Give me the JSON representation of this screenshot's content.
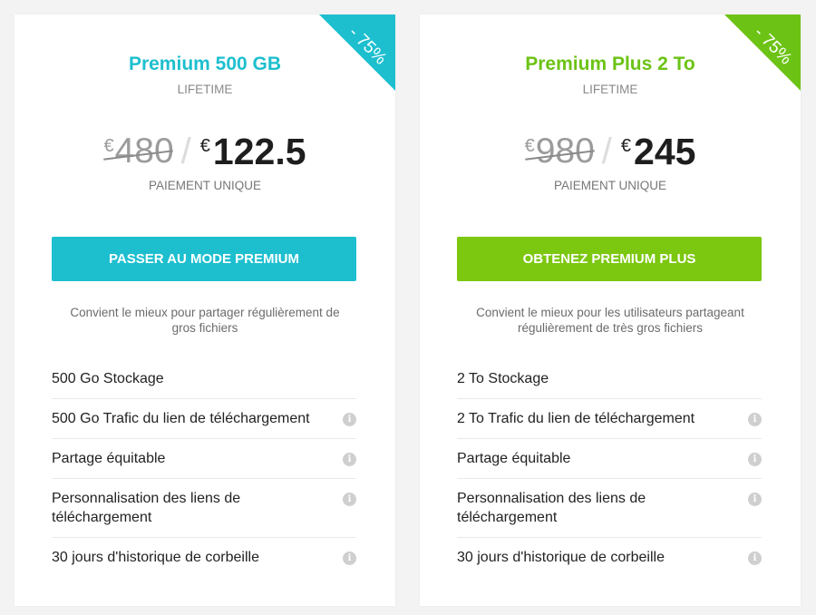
{
  "plans": [
    {
      "ribbon": "- 75%",
      "title": "Premium 500 GB",
      "term": "LIFETIME",
      "currency": "€",
      "old_price": "480",
      "separator": "/",
      "new_price": "122.5",
      "payment_note": "PAIEMENT UNIQUE",
      "cta_label": "PASSER AU MODE PREMIUM",
      "description": "Convient le mieux pour partager régulièrement de gros fichiers",
      "accent_color": "#1dbfcf",
      "button_color": "#1dbfcf",
      "features": [
        {
          "label": "500 Go Stockage",
          "icon": null
        },
        {
          "label": "500 Go Trafic du lien de téléchargement",
          "icon": "info-icon"
        },
        {
          "label": "Partage équitable",
          "icon": "info-icon"
        },
        {
          "label": "Personnalisation des liens de téléchargement",
          "icon": "info-icon"
        },
        {
          "label": "30 jours d'historique de corbeille",
          "icon": "info-icon"
        }
      ]
    },
    {
      "ribbon": "- 75%",
      "title": "Premium Plus 2 To",
      "term": "LIFETIME",
      "currency": "€",
      "old_price": "980",
      "separator": "/",
      "new_price": "245",
      "payment_note": "PAIEMENT UNIQUE",
      "cta_label": "OBTENEZ PREMIUM PLUS",
      "description": "Convient le mieux pour les utilisateurs partageant régulièrement de très gros fichiers",
      "accent_color": "#6cc315",
      "button_color": "#7cc70f",
      "features": [
        {
          "label": "2 To Stockage",
          "icon": null
        },
        {
          "label": "2 To Trafic du lien de téléchargement",
          "icon": "info-icon"
        },
        {
          "label": "Partage équitable",
          "icon": "info-icon"
        },
        {
          "label": "Personnalisation des liens de téléchargement",
          "icon": "info-icon"
        },
        {
          "label": "30 jours d'historique de corbeille",
          "icon": "info-icon"
        }
      ]
    }
  ]
}
